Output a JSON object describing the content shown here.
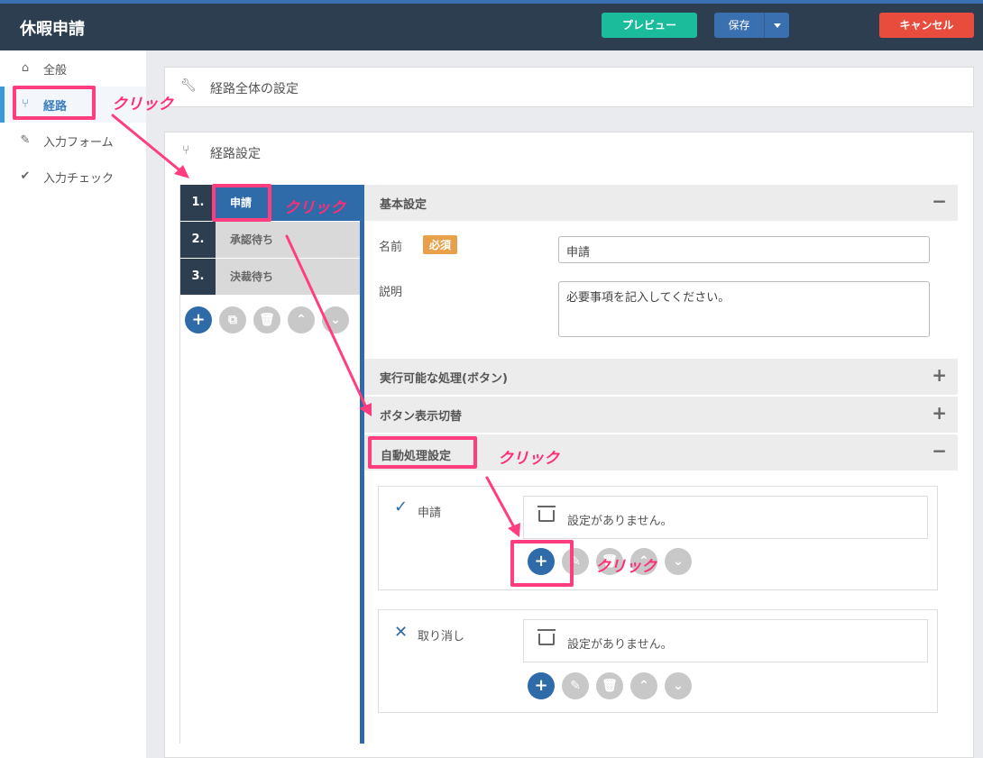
{
  "app": {
    "title": "休暇申請"
  },
  "toolbar": {
    "preview_label": "プレビュー",
    "save_label": "保存",
    "cancel_label": "キャンセル"
  },
  "sidebar": {
    "items": [
      {
        "label": "全般",
        "icon": "home-icon"
      },
      {
        "label": "経路",
        "icon": "route-icon",
        "active": true
      },
      {
        "label": "入力フォーム",
        "icon": "pencil-icon"
      },
      {
        "label": "入力チェック",
        "icon": "check-icon"
      }
    ]
  },
  "panels": {
    "global_settings": "経路全体の設定",
    "route_settings": "経路設定"
  },
  "steps": [
    {
      "num": "1.",
      "label": "申請"
    },
    {
      "num": "2.",
      "label": "承認待ち"
    },
    {
      "num": "3.",
      "label": "決裁待ち"
    }
  ],
  "sections": {
    "basic": "基本設定",
    "actions": "実行可能な処理(ボタン)",
    "button_toggle": "ボタン表示切替",
    "auto": "自動処理設定"
  },
  "form": {
    "name_label": "名前",
    "required_badge": "必須",
    "name_value": "申請",
    "desc_label": "説明",
    "desc_value": "必要事項を記入してください。"
  },
  "auto": {
    "items": [
      {
        "label": "申請",
        "empty_text": "設定がありません。"
      },
      {
        "label": "取り消し",
        "empty_text": "設定がありません。"
      }
    ]
  },
  "annotations": {
    "click": "クリック"
  },
  "colors": {
    "accent": "#2f6ba8",
    "topbar": "#2c3e50",
    "preview": "#1abc9c",
    "cancel": "#e74c3c",
    "highlight": "#ff3d7f"
  }
}
